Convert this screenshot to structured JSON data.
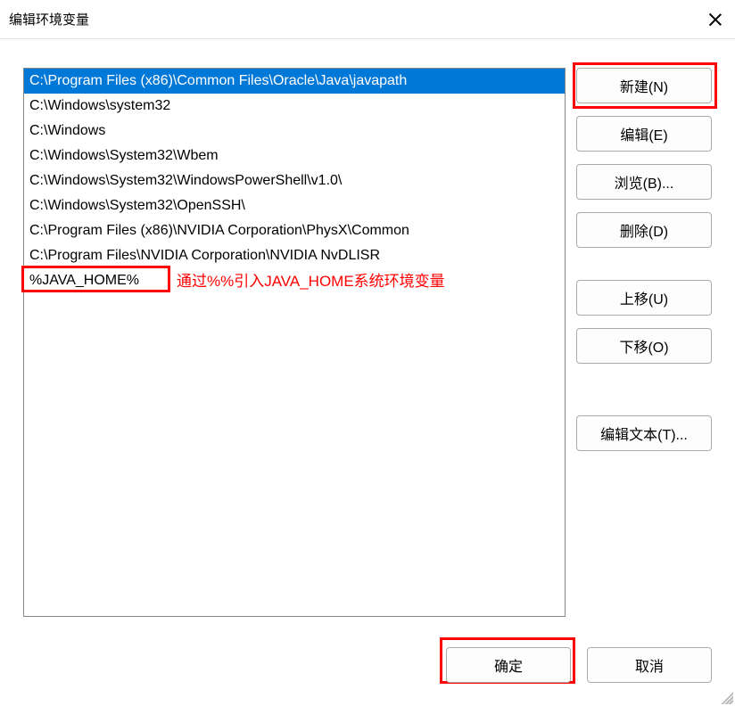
{
  "dialog": {
    "title": "编辑环境变量"
  },
  "list": {
    "items": [
      "C:\\Program Files (x86)\\Common Files\\Oracle\\Java\\javapath",
      "C:\\Windows\\system32",
      "C:\\Windows",
      "C:\\Windows\\System32\\Wbem",
      "C:\\Windows\\System32\\WindowsPowerShell\\v1.0\\",
      "C:\\Windows\\System32\\OpenSSH\\",
      "C:\\Program Files (x86)\\NVIDIA Corporation\\PhysX\\Common",
      "C:\\Program Files\\NVIDIA Corporation\\NVIDIA NvDLISR",
      "%JAVA_HOME%"
    ],
    "selected_index": 0
  },
  "annotation": {
    "text": "通过%%引入JAVA_HOME系统环境变量"
  },
  "buttons": {
    "new": "新建(N)",
    "edit": "编辑(E)",
    "browse": "浏览(B)...",
    "delete": "删除(D)",
    "move_up": "上移(U)",
    "move_down": "下移(O)",
    "edit_text": "编辑文本(T)...",
    "ok": "确定",
    "cancel": "取消"
  }
}
